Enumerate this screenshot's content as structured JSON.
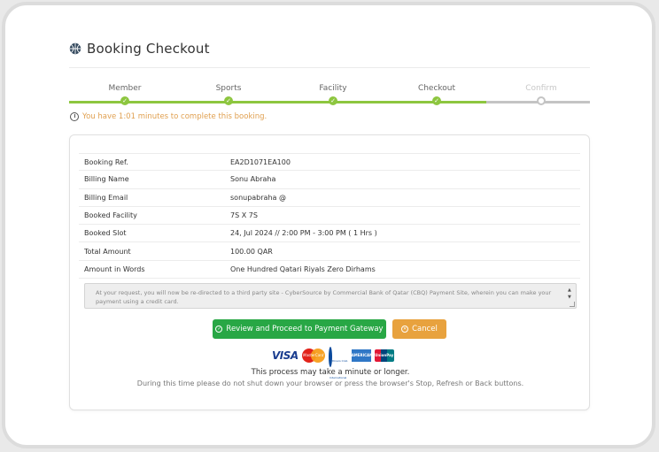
{
  "page": {
    "title": "Booking Checkout",
    "logo_icon": "basketball-icon"
  },
  "stepper": {
    "steps": [
      {
        "label": "Member",
        "state": "done"
      },
      {
        "label": "Sports",
        "state": "done"
      },
      {
        "label": "Facility",
        "state": "done"
      },
      {
        "label": "Checkout",
        "state": "done"
      },
      {
        "label": "Confirm",
        "state": "pending"
      }
    ],
    "done_color": "#8dc63f",
    "pending_color": "#c4c4c4"
  },
  "timer": {
    "message": "You have 1:01 minutes to complete this booking.",
    "color": "#e0a050"
  },
  "booking": {
    "rows": [
      {
        "label": "Booking Ref.",
        "value": "EA2D1071EA100"
      },
      {
        "label": "Billing Name",
        "value": "Sonu Abraha"
      },
      {
        "label": "Billing Email",
        "value": "sonupabraha   @"
      },
      {
        "label": "Booked Facility",
        "value": "7S X 7S"
      },
      {
        "label": "Booked Slot",
        "value": "24, Jul 2024 // 2:00 PM - 3:00 PM ( 1 Hrs )"
      },
      {
        "label": "Total Amount",
        "value": "100.00 QAR"
      },
      {
        "label": "Amount in Words",
        "value": "One Hundred Qatari Riyals Zero Dirhams"
      }
    ]
  },
  "notice": {
    "text": "At your request, you will now be re-directed to a third party site - CyberSource by Commercial Bank of Qatar (CBQ) Payment Site, wherein you can make your payment using a credit card."
  },
  "actions": {
    "pay_label": "Review and Proceed to Payment Gateway",
    "cancel_label": "Cancel",
    "pay_color": "#28a745",
    "cancel_color": "#e8a23e"
  },
  "payment_logos": {
    "visa": "VISA",
    "mastercard": "MasterCard",
    "diners": "Diners Club International",
    "amex": "AMERICAN EXPRESS",
    "unionpay": "UnionPay"
  },
  "footer": {
    "line1": "This process may take a minute or longer.",
    "line2": "During this time please do not shut down your browser or press the browser's Stop, Refresh or Back buttons."
  }
}
